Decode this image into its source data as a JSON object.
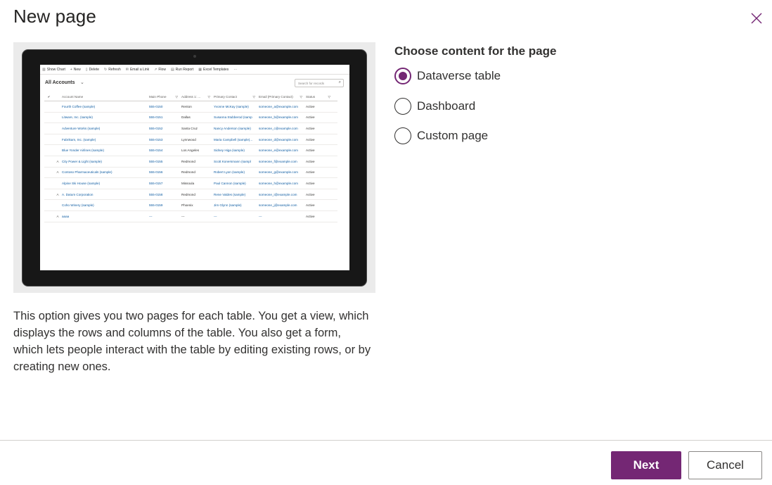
{
  "dialog": {
    "title": "New page",
    "close_icon": "close-icon",
    "accent_color": "#742774"
  },
  "preview": {
    "toolbar": [
      {
        "icon": "chart-icon",
        "label": "Show Chart"
      },
      {
        "icon": "plus-icon",
        "label": "New"
      },
      {
        "icon": "trash-icon",
        "label": "Delete"
      },
      {
        "icon": "refresh-icon",
        "label": "Refresh"
      },
      {
        "icon": "mail-icon",
        "label": "Email a Link"
      },
      {
        "icon": "flow-icon",
        "label": "Flow"
      },
      {
        "icon": "report-icon",
        "label": "Run Report"
      },
      {
        "icon": "excel-icon",
        "label": "Excel Templates"
      }
    ],
    "view_title": "All Accounts",
    "search_placeholder": "Search for records",
    "columns": [
      "Account Name",
      "Main Phone",
      "Address 1: ...",
      "Primary Contact",
      "Email (Primary Contact)",
      "Status"
    ],
    "rows": [
      {
        "icon": "",
        "name": "Fourth Coffee (sample)",
        "phone": "555-0150",
        "city": "Renton",
        "contact": "Yvonne McKay (sample)",
        "email": "someone_a@example.com",
        "status": "Active"
      },
      {
        "icon": "",
        "name": "Litware, Inc. (sample)",
        "phone": "555-0151",
        "city": "Dallas",
        "contact": "Susanna Stubberod (samp",
        "email": "someone_b@example.com",
        "status": "Active"
      },
      {
        "icon": "",
        "name": "Adventure Works (sample)",
        "phone": "555-0152",
        "city": "Santa Cruz",
        "contact": "Nancy Anderson (sample)",
        "email": "someone_c@example.com",
        "status": "Active"
      },
      {
        "icon": "",
        "name": "Fabrikam, Inc. (sample)",
        "phone": "555-0153",
        "city": "Lynnwood",
        "contact": "Maria Campbell (sample)...",
        "email": "someone_d@example.com",
        "status": "Active"
      },
      {
        "icon": "",
        "name": "Blue Yonder Airlines (sample)",
        "phone": "555-0154",
        "city": "Los Angeles",
        "contact": "Sidney Higa (sample)",
        "email": "someone_e@example.com",
        "status": "Active"
      },
      {
        "icon": "A",
        "name": "City Power & Light (sample)",
        "phone": "555-0155",
        "city": "Redmond",
        "contact": "Scott Konersmann (sampl",
        "email": "someone_f@example.com",
        "status": "Active"
      },
      {
        "icon": "A",
        "name": "Contoso Pharmaceuticals (sample)",
        "phone": "555-0156",
        "city": "Redmond",
        "contact": "Robert Lyon (sample)",
        "email": "someone_g@example.com",
        "status": "Active"
      },
      {
        "icon": "",
        "name": "Alpine Ski House (sample)",
        "phone": "555-0157",
        "city": "Missoula",
        "contact": "Paul Cannon (sample)",
        "email": "someone_h@example.com",
        "status": "Active"
      },
      {
        "icon": "A",
        "name": "A. Datum Corporation",
        "phone": "555-0158",
        "city": "Redmond",
        "contact": "Rene Valdes (sample)",
        "email": "someone_i@example.com",
        "status": "Active"
      },
      {
        "icon": "",
        "name": "Coho Winery (sample)",
        "phone": "555-0159",
        "city": "Phoenix",
        "contact": "Jim Glynn (sample)",
        "email": "someone_j@example.com",
        "status": "Active"
      },
      {
        "icon": "A",
        "name": "aaaa",
        "phone": "---",
        "city": "---",
        "contact": "---",
        "email": "---",
        "status": "Active"
      }
    ]
  },
  "content_choice": {
    "label": "Choose content for the page",
    "options": [
      {
        "label": "Dataverse table",
        "checked": true
      },
      {
        "label": "Dashboard",
        "checked": false
      },
      {
        "label": "Custom page",
        "checked": false
      }
    ]
  },
  "description": "This option gives you two pages for each table. You get a view, which displays the rows and columns of the table. You also get a form, which lets people interact with the table by editing existing rows, or by creating new ones.",
  "footer": {
    "next_label": "Next",
    "cancel_label": "Cancel"
  }
}
